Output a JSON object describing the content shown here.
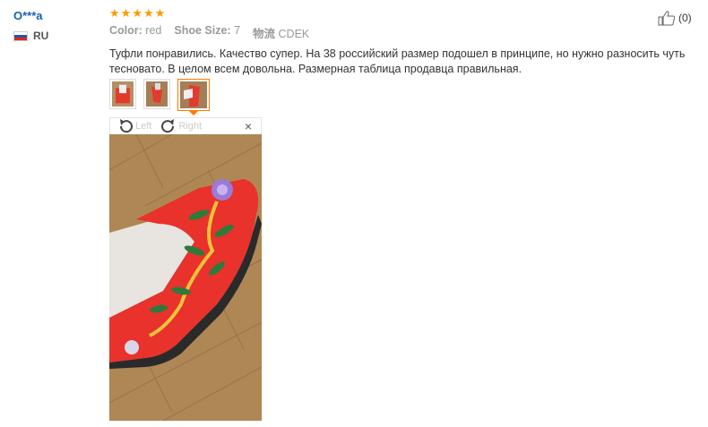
{
  "user": {
    "name": "O***a",
    "country": "RU"
  },
  "review": {
    "stars": 5,
    "color_label": "Color:",
    "color_value": "red",
    "size_label": "Shoe Size:",
    "size_value": "7",
    "shipping_label": "物流",
    "shipping_value": "CDEK",
    "text": "Туфли понравились. Качество супер. На 38 российский размер подошел в принципе, но нужно разносить чуть тесновато. В целом всем довольна. Размерная таблица продавца правильная."
  },
  "useful": {
    "count": "(0)"
  },
  "viewer": {
    "left_label": "Left",
    "right_label": "Right",
    "close_symbol": "×"
  },
  "colors": {
    "star": "#ff9900",
    "accent": "#ff7a00",
    "link": "#1a5fb4"
  },
  "icons": [
    "thumbs-up-icon",
    "rotate-left-icon",
    "rotate-right-icon",
    "close-icon",
    "star-icon"
  ]
}
